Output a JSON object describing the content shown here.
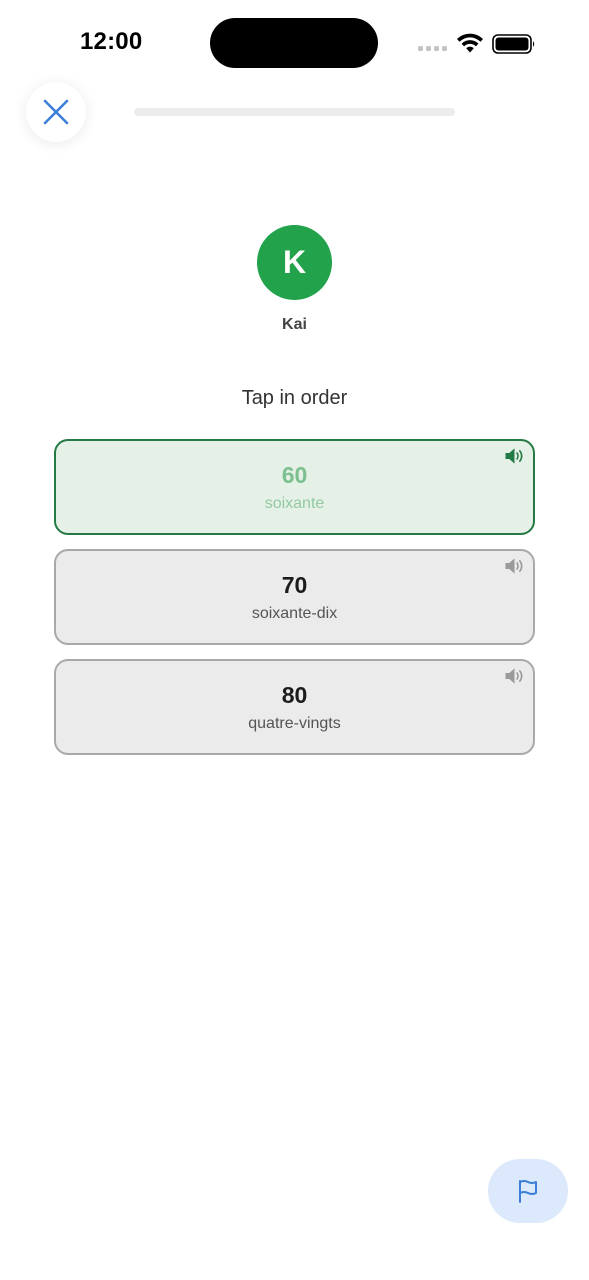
{
  "status_bar": {
    "time": "12:00"
  },
  "header": {
    "close_icon": "close-x-icon",
    "progress": 0.0
  },
  "speaker": {
    "name": "Kai",
    "initial": "K",
    "avatar_color": "#22a24a"
  },
  "instruction": "Tap in order",
  "options": [
    {
      "number": "60",
      "word": "soixante",
      "state": "selected"
    },
    {
      "number": "70",
      "word": "soixante-dix",
      "state": "default"
    },
    {
      "number": "80",
      "word": "quatre-vingts",
      "state": "default"
    }
  ],
  "footer": {
    "flag_icon": "flag-icon"
  },
  "colors": {
    "accent_blue": "#3b7fd9",
    "selected_border": "#247a44",
    "selected_bg": "#e5f0e7",
    "card_bg": "#ebebeb",
    "card_border": "#a9a9a9",
    "flag_bg": "#dce8fb"
  }
}
